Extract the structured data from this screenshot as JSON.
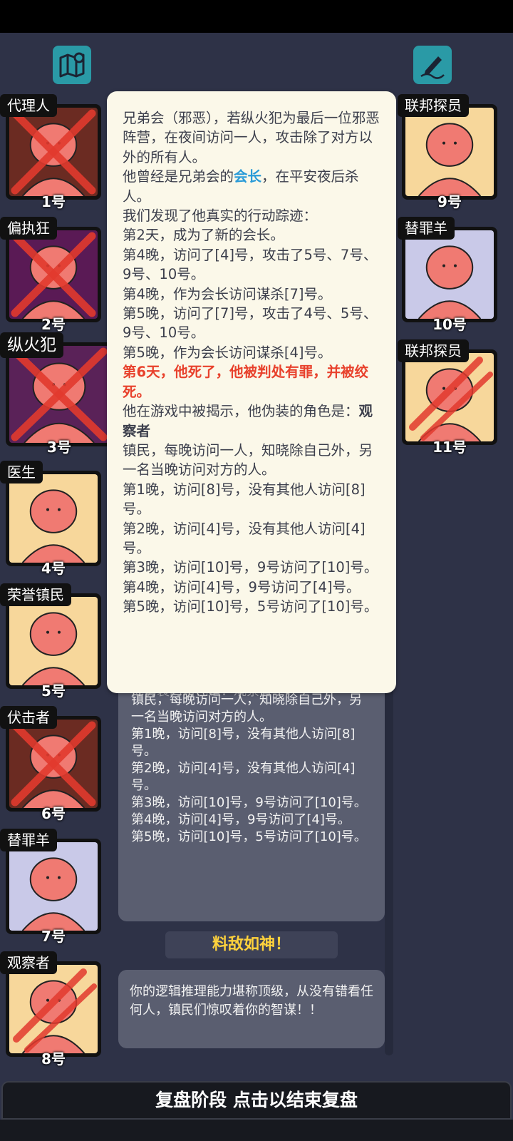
{
  "top_icons": {
    "left": "map-icon",
    "right": "edit-note-icon"
  },
  "players_left": [
    {
      "role": "代理人",
      "number": "1号",
      "dead": true,
      "bg": "#6b2b22"
    },
    {
      "role": "偏执狂",
      "number": "2号",
      "dead": true,
      "bg": "#5a1a55"
    },
    {
      "role": "纵火犯",
      "number": "3号",
      "dead": true,
      "bg": "#5a2258"
    },
    {
      "role": "医生",
      "number": "4号",
      "dead": false,
      "bg": "#f7d79b"
    },
    {
      "role": "荣誉镇民",
      "number": "5号",
      "dead": false,
      "bg": "#f7d79b"
    },
    {
      "role": "伏击者",
      "number": "6号",
      "dead": true,
      "bg": "#6b2b22"
    },
    {
      "role": "替罪羊",
      "number": "7号",
      "dead": false,
      "bg": "#c9c9e8"
    },
    {
      "role": "观察者",
      "number": "8号",
      "dead": true,
      "bg": "#f7d79b"
    }
  ],
  "players_right": [
    {
      "role": "联邦探员",
      "number": "9号",
      "dead": false,
      "bg": "#f7d79b"
    },
    {
      "role": "替罪羊",
      "number": "10号",
      "dead": false,
      "bg": "#c9c9e8"
    },
    {
      "role": "联邦探员",
      "number": "11号",
      "dead": true,
      "bg": "#f7d79b"
    }
  ],
  "popup": {
    "p1": "兄弟会（邪恶），若纵火犯为最后一位邪恶阵营，在夜间访问一人，攻击除了对方以外的所有人。",
    "p2a": "他曾经是兄弟会的",
    "p2b": "会长",
    "p2c": "，在平安夜后杀人。",
    "p3": "我们发现了他真实的行动踪迹：",
    "lines1": [
      "第2天，成为了新的会长。",
      "第4晚，访问了[4]号，攻击了5号、7号、9号、10号。",
      "第4晚，作为会长访问谋杀[7]号。",
      "第5晚，访问了[7]号，攻击了4号、5号、9号、10号。",
      "第5晚，作为会长访问谋杀[4]号。"
    ],
    "death": "第6天，他死了，他被判处有罪，并被绞死。",
    "p4a": "他在游戏中被揭示，他伪装的角色是：",
    "p4b": "观察者",
    "lines2": [
      "镇民，每晚访问一人，知晓除自己外，另一名当晚访问对方的人。",
      "第1晚，访问[8]号，没有其他人访问[8]号。",
      "第2晚，访问[4]号，没有其他人访问[4]号。",
      "第3晚，访问[10]号，9号访问了[10]号。",
      "第4晚，访问[4]号，9号访问了[4]号。",
      "第5晚，访问[10]号，5号访问了[10]号。"
    ]
  },
  "log_panel": {
    "ghost_line": "他伪装的角色是：观察者",
    "lines": [
      "镇民，每晚访问一人，知晓除自己外，另一名当晚访问对方的人。",
      "第1晚，访问[8]号，没有其他人访问[8]号。",
      "第2晚，访问[4]号，没有其他人访问[4]号。",
      "第3晚，访问[10]号，9号访问了[10]号。",
      "第4晚，访问[4]号，9号访问了[4]号。",
      "第5晚，访问[10]号，5号访问了[10]号。"
    ]
  },
  "award": {
    "title": "料敌如神！",
    "text": "你的逻辑推理能力堪称顶级，从没有错看任何人，镇民们惊叹着你的智谋！！"
  },
  "bottom_bar": "复盘阶段 点击以结束复盘",
  "colors": {
    "accent_blue": "#2a9bd8",
    "death_red": "#e8412c",
    "gold": "#ffd23c",
    "x_red": "#e23a2e"
  }
}
